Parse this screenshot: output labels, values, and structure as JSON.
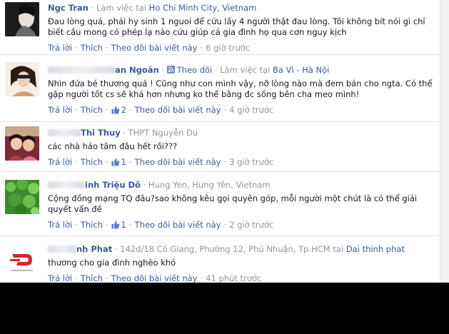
{
  "comments": [
    {
      "name": "Ngc Tran",
      "work_prefix": "Làm việc tại",
      "work_place": "Ho Chi Minh City, Vietnam",
      "text": "Đau lòng quá, phải hy sinh 1 nguoi để cứu lấy 4 người thật đau lòng. Tôi không bít nói gì chỉ biết cầu mong có phép lạ nào cứu giúp cả gia đình họ qua cơn nguy kịch",
      "reply": "Trả lời",
      "like": "Thích",
      "follow": "Theo dõi bài viết này",
      "time": "6 giờ trước"
    },
    {
      "name": "an Ngoãn",
      "follow_label": "Theo dõi",
      "work_prefix": "Làm việc tại",
      "work_place": "Ba Vì - Hà Nội",
      "text": "Nhìn đứa bé thương quá ! Cũng như con mình vậy, nỡ lòng nào mà đem bán cho ngta. Có thể gặp người tốt cs sẽ khá hơn nhưng ko thể bằng đc sống bên cha meo mình!",
      "reply": "Trả lời",
      "like": "Thích",
      "likes": "2",
      "follow": "Theo dõi bài viết này",
      "time": "4 giờ trước"
    },
    {
      "name": "Thi Thuy",
      "school": "THPT Nguyễn Du",
      "text": "các nhà hảo tâm đâu hết rồi???",
      "reply": "Trả lời",
      "like": "Thích",
      "likes": "1",
      "follow": "Theo dõi bài viết này",
      "time": "3 giờ trước"
    },
    {
      "name": "inh Triệu Dô",
      "location": "Hung Yen, Hưng Yên, Vietnam",
      "text": "Cộng đồng mạng TQ đâu?sao không kêu gọi quyên góp, mỗi người một chút là có thể giải quyết vấn đề",
      "reply": "Trả lời",
      "like": "Thích",
      "likes": "1",
      "follow": "Theo dõi bài viết này",
      "time": "2 giờ trước"
    },
    {
      "name": "nh Phat",
      "address": "142d/18 Cô Giang, Phường 12, Phú Nhuận, Tp.HCM",
      "work_prefix": "tại",
      "work_place": "Dai thinh phat",
      "text": "thương cho gia đình nghèo khó",
      "reply": "Trả lời",
      "like": "Thích",
      "follow": "Theo dõi bài viết này",
      "time": "41 phút trước"
    }
  ],
  "colors": {
    "link": "#3b5998",
    "meta": "#90949c",
    "text": "#141823",
    "divider": "#e1e2e3",
    "background_below": "#000000"
  },
  "icons": [
    "thumb-up-icon",
    "rss-follow-icon"
  ]
}
